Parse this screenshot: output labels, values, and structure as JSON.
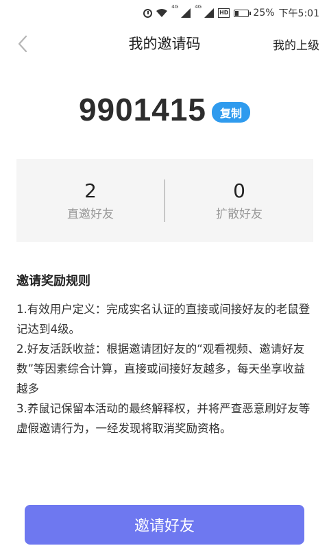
{
  "status_bar": {
    "network_4g_1": "4G",
    "network_4g_2": "4G",
    "hd_label": "HD",
    "battery_percent": "25%",
    "battery_level": 0.25,
    "time": "下午5:01"
  },
  "nav": {
    "title": "我的邀请码",
    "superior_label": "我的上级"
  },
  "invite": {
    "code": "9901415",
    "copy_label": "复制"
  },
  "stats": {
    "direct": {
      "value": "2",
      "label": "直邀好友"
    },
    "spread": {
      "value": "0",
      "label": "扩散好友"
    }
  },
  "rules": {
    "title": "邀请奖励规则",
    "items": [
      "1.有效用户定义：完成实名认证的直接或间接好友的老鼠登记达到4级。",
      "2.好友活跃收益：根据邀请团好友的“观看视频、邀请好友数”等因素综合计算，直接或间接好友越多，每天坐享收益越多",
      "3.养鼠记保留本活动的最终解释权，并将严查恶意刷好友等虚假邀请行为，一经发现将取消奖励资格。"
    ]
  },
  "actions": {
    "invite_button_label": "邀请好友"
  },
  "colors": {
    "copy_button": "#2f9bee",
    "invite_button": "#6e78f0",
    "stats_background": "#f5f5f5"
  }
}
